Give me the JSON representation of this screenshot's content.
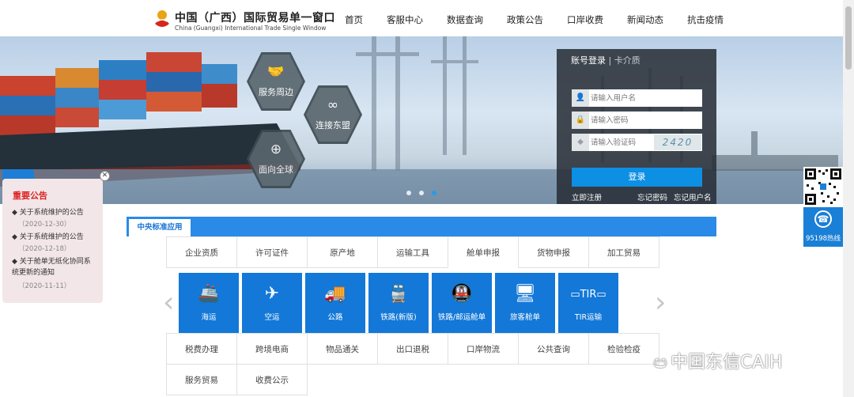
{
  "header": {
    "logo_cn": "中国（广西）国际贸易单一窗口",
    "logo_en": "China (Guangxi) International Trade Single Window",
    "nav": [
      "首页",
      "客服中心",
      "数据查询",
      "政策公告",
      "口岸收费",
      "新闻动态",
      "抗击疫情"
    ]
  },
  "banner": {
    "hex": [
      "服务周边",
      "连接东盟",
      "面向全球"
    ],
    "slide_index": 3,
    "slide_count": 3
  },
  "login": {
    "tab_active": "账号登录",
    "tab_inactive": "卡介质",
    "username_placeholder": "请输入用户名",
    "password_placeholder": "请输入密码",
    "captcha_placeholder": "请输入验证码",
    "captcha_text": "2420",
    "button": "登录",
    "register": "立即注册",
    "forgot_password": "忘记密码",
    "forgot_username": "忘记用户名"
  },
  "side": {
    "hotline": "95198热线"
  },
  "notice": {
    "title": "重要公告",
    "items": [
      {
        "text": "关于系统维护的公告",
        "date": "（2020-12-30）"
      },
      {
        "text": "关于系统维护的公告",
        "date": "（2020-12-18）"
      },
      {
        "text": "关于舱单无纸化协同系统更新的通知",
        "date": "（2020-11-11）"
      }
    ]
  },
  "section": {
    "tab": "中央标准应用"
  },
  "categories_row1": [
    "企业资质",
    "许可证件",
    "原产地",
    "运输工具",
    "舱单申报",
    "货物申报",
    "加工贸易"
  ],
  "categories_row2": [
    "税费办理",
    "跨境电商",
    "物品通关",
    "出口退税",
    "口岸物流",
    "公共查询",
    "检验检疫"
  ],
  "categories_row3": [
    "服务贸易",
    "收费公示"
  ],
  "selected_category": "舱单申报",
  "tiles": [
    {
      "label": "海运",
      "icon": "ship-icon"
    },
    {
      "label": "空运",
      "icon": "plane-icon"
    },
    {
      "label": "公路",
      "icon": "truck-icon"
    },
    {
      "label": "铁路(新版)",
      "icon": "train-icon"
    },
    {
      "label": "铁路/邮运舱单",
      "icon": "rail-icon"
    },
    {
      "label": "旅客舱单",
      "icon": "passenger-icon"
    },
    {
      "label": "TIR运输",
      "icon": "tir-icon"
    }
  ],
  "watermark": "中国东信CAIH"
}
